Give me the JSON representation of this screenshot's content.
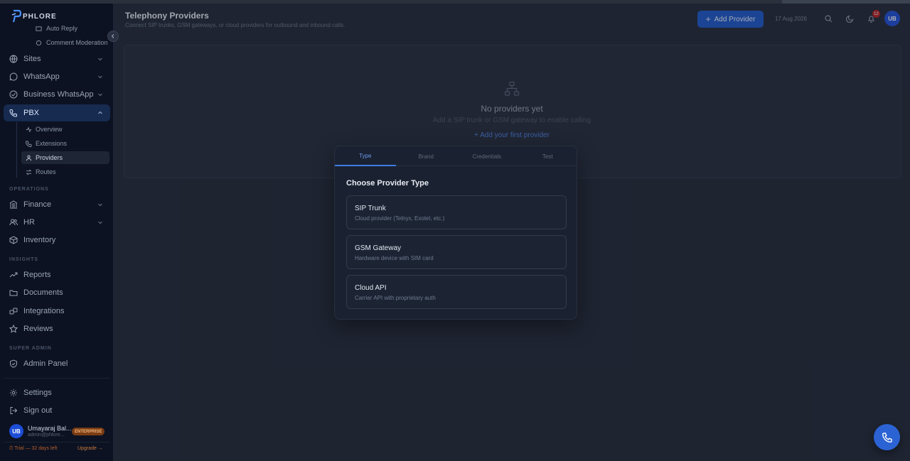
{
  "brand": {
    "logo_text": "PHLORE"
  },
  "sidebar": {
    "sub_top": [
      {
        "label": "Auto Reply"
      },
      {
        "label": "Comment Moderation"
      }
    ],
    "items": [
      {
        "label": "Sites",
        "icon": "globe-icon"
      },
      {
        "label": "WhatsApp",
        "icon": "chat-icon"
      },
      {
        "label": "Business WhatsApp",
        "icon": "check-circle-icon"
      },
      {
        "label": "PBX",
        "icon": "phone-icon"
      }
    ],
    "pbx_sub": [
      {
        "label": "Overview",
        "icon": "activity-icon"
      },
      {
        "label": "Extensions",
        "icon": "phone-icon"
      },
      {
        "label": "Providers",
        "icon": "network-icon"
      },
      {
        "label": "Routes",
        "icon": "route-icon"
      }
    ],
    "sections": {
      "operations": "OPERATIONS",
      "insights": "INSIGHTS",
      "super_admin": "SUPER ADMIN"
    },
    "ops": [
      {
        "label": "Finance",
        "icon": "bank-icon"
      },
      {
        "label": "HR",
        "icon": "users-icon"
      },
      {
        "label": "Inventory",
        "icon": "box-icon"
      }
    ],
    "insights": [
      {
        "label": "Reports",
        "icon": "trend-icon"
      },
      {
        "label": "Documents",
        "icon": "folder-icon"
      },
      {
        "label": "Integrations",
        "icon": "link-icon"
      },
      {
        "label": "Reviews",
        "icon": "star-icon"
      }
    ],
    "admin": [
      {
        "label": "Admin Panel",
        "icon": "shield-icon"
      }
    ],
    "bottom": [
      {
        "label": "Settings",
        "icon": "gear-icon"
      },
      {
        "label": "Sign out",
        "icon": "logout-icon"
      }
    ],
    "user": {
      "initials": "UB",
      "name": "Umayaraj Bal...",
      "email": "admin@phlore...",
      "plan": "ENTERPRISE"
    },
    "trial": "⏱ Trial — 32 days left",
    "upgrade": "Upgrade →"
  },
  "header": {
    "title": "Telephony Providers",
    "subtitle": "Connect SIP trunks, GSM gateways, or cloud providers for outbound and inbound calls.",
    "add_button": "Add Provider",
    "date": "17 Aug 2026",
    "notif_count": "12",
    "avatar": "UB"
  },
  "empty": {
    "title": "No providers yet",
    "subtitle": "Add a SIP trunk or GSM gateway to enable calling",
    "link": "+ Add your first provider"
  },
  "modal": {
    "tabs": [
      "Type",
      "Brand",
      "Credentials",
      "Test"
    ],
    "active_tab": "Type",
    "title": "Choose Provider Type",
    "options": [
      {
        "title": "SIP Trunk",
        "desc": "Cloud provider (Telnyx, Exotel, etc.)"
      },
      {
        "title": "GSM Gateway",
        "desc": "Hardware device with SIM card"
      },
      {
        "title": "Cloud API",
        "desc": "Carrier API with proprietary auth"
      }
    ]
  },
  "colors": {
    "accent": "#1c56c9",
    "sidebar_bg": "#0c1222",
    "page_bg": "#1f2532"
  }
}
